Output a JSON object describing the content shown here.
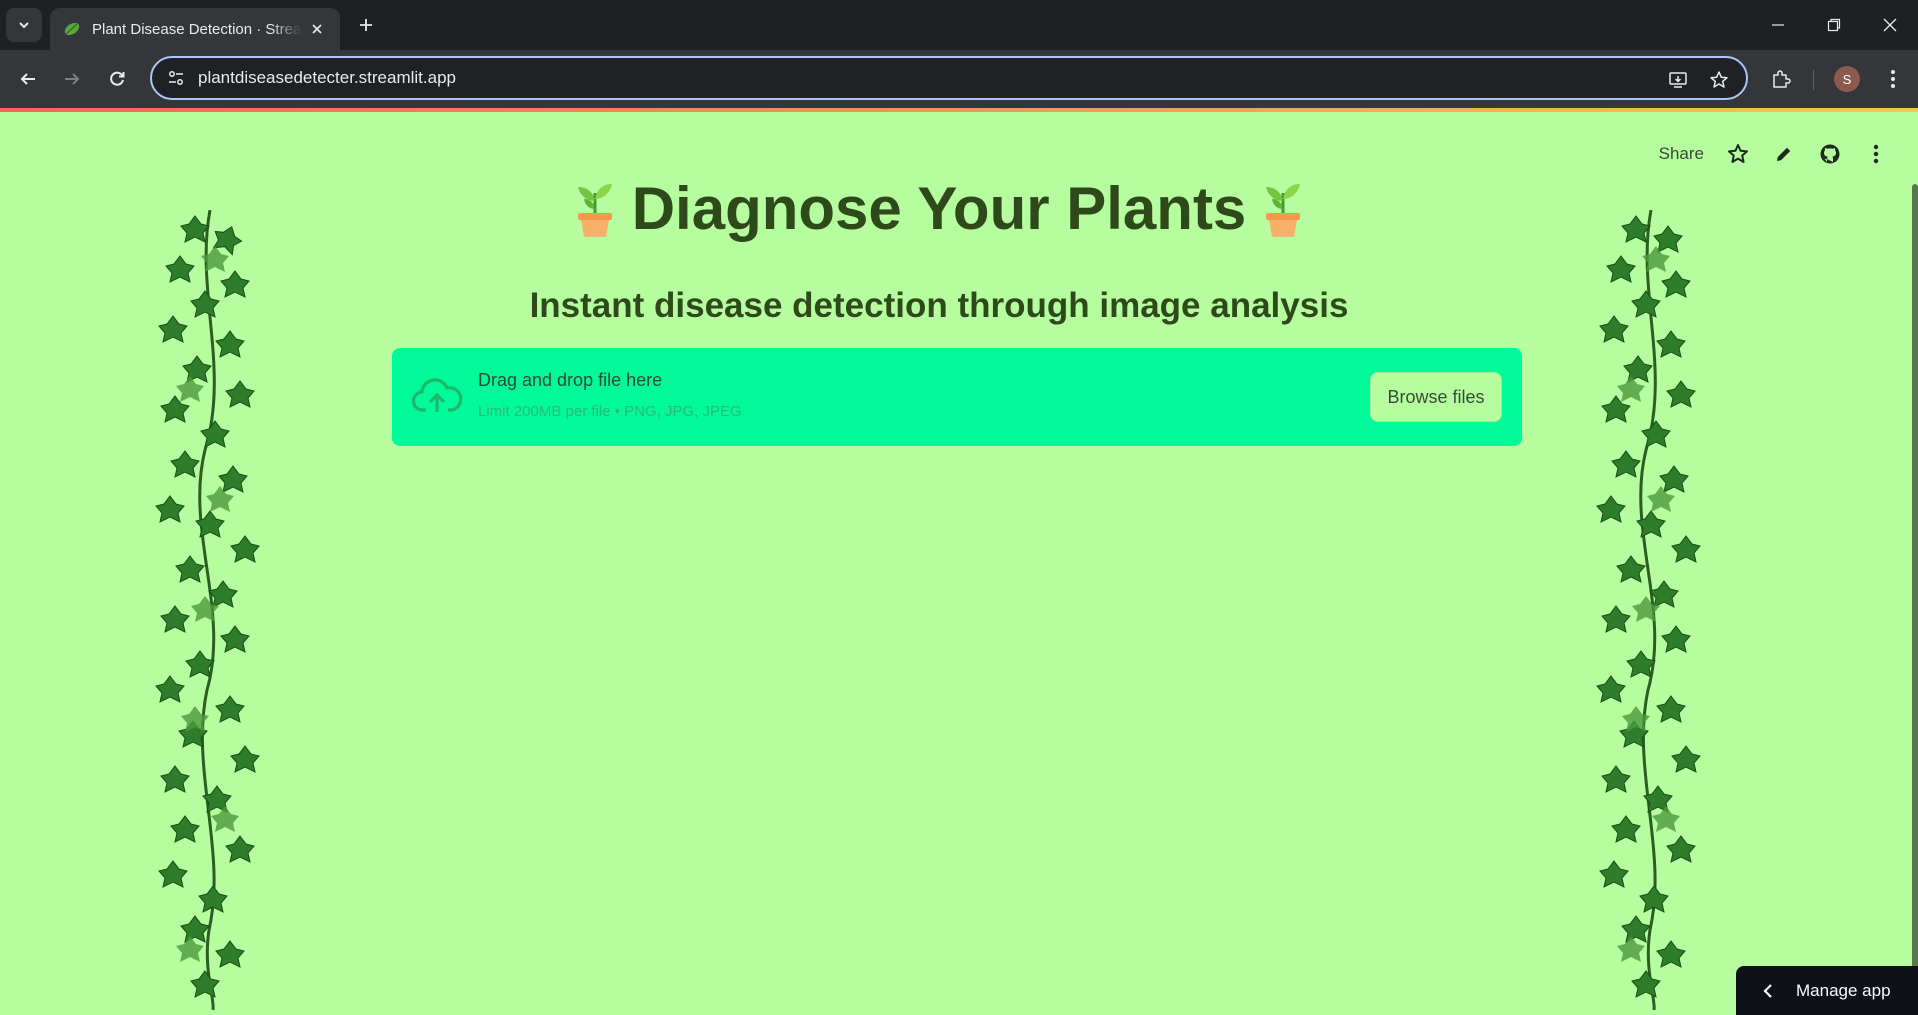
{
  "browser": {
    "tab_title": "Plant Disease Detection · Streamlit",
    "url": "plantdiseasedetecter.streamlit.app",
    "profile_initial": "S"
  },
  "app_header": {
    "share_label": "Share"
  },
  "main": {
    "title": "Diagnose Your Plants",
    "subtitle": "Instant disease detection through image analysis"
  },
  "uploader": {
    "title": "Drag and drop file here",
    "limit": "Limit 200MB per file • PNG, JPG, JPEG",
    "button_label": "Browse files"
  },
  "manage_app": {
    "label": "Manage app"
  },
  "colors": {
    "background": "#b5fd9e",
    "uploader_bg": "#00fa9a",
    "title_text": "#2f4a1a",
    "upload_icon": "#1fb86a"
  }
}
